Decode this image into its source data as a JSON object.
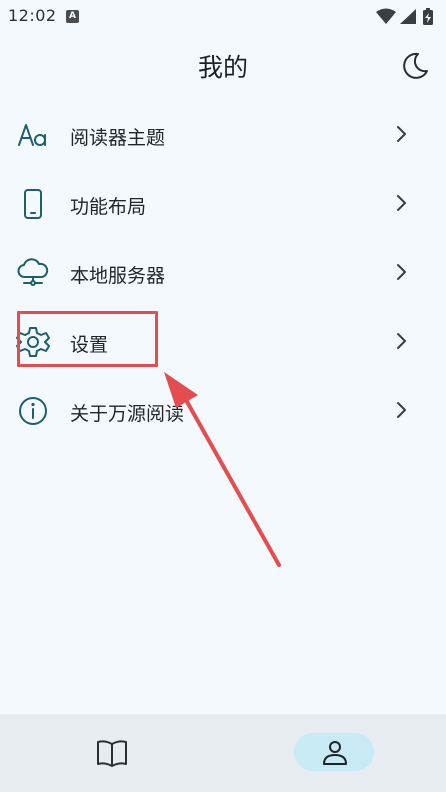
{
  "status_bar": {
    "time": "12:02",
    "notification_letter": "A"
  },
  "header": {
    "title": "我的",
    "theme_toggle_icon": "moon-icon"
  },
  "menu": {
    "items": [
      {
        "label": "阅读器主题",
        "icon": "font-aa-icon"
      },
      {
        "label": "功能布局",
        "icon": "phone-icon"
      },
      {
        "label": "本地服务器",
        "icon": "cloud-server-icon"
      },
      {
        "label": "设置",
        "icon": "gear-icon"
      },
      {
        "label": "关于万源阅读",
        "icon": "info-icon"
      }
    ]
  },
  "annotation": {
    "color": "#e34d50",
    "target": "设置"
  },
  "bottom_nav": {
    "items": [
      {
        "icon": "book-icon",
        "active": false
      },
      {
        "icon": "person-icon",
        "active": true
      }
    ]
  },
  "colors": {
    "background": "#f3f9fc",
    "icon_teal": "#1f5f6c",
    "active_pill": "#c8eaf5",
    "nav_bg": "#e6ecef"
  }
}
